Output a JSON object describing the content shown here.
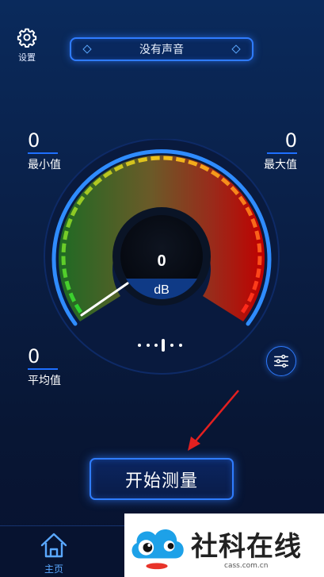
{
  "header": {
    "settings_label": "设置",
    "status_text": "没有声音"
  },
  "stats": {
    "min": {
      "value": "0",
      "label": "最小值"
    },
    "max": {
      "value": "0",
      "label": "最大值"
    },
    "avg": {
      "value": "0",
      "label": "平均值"
    }
  },
  "gauge": {
    "value": "0",
    "unit": "dB",
    "level": 0
  },
  "actions": {
    "start_label": "开始测量"
  },
  "nav": {
    "home_label": "主页"
  },
  "watermark": {
    "title": "社科在线",
    "url": "cass.com.cn"
  },
  "colors": {
    "accent": "#2f7cff",
    "background": "#0a1f46",
    "gauge_low": "#2fd12f",
    "gauge_mid": "#f1c21b",
    "gauge_high": "#ff2a1a"
  },
  "icons": {
    "settings": "gear-icon",
    "filter": "sliders-icon",
    "home": "home-icon"
  }
}
